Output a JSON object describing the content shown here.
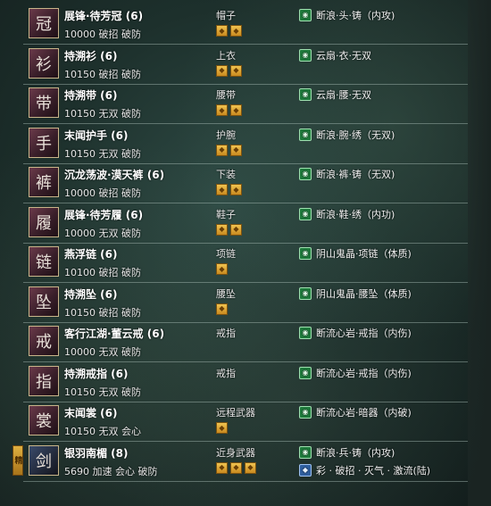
{
  "items": [
    {
      "name": "展锋·待芳冠 (6)",
      "stats": "10000 破招 破防",
      "slot": "帽子",
      "gems": 2,
      "enchant": "断浪·头·铸（内攻)",
      "enchant_icon": "jade-icon"
    },
    {
      "name": "持溯衫 (6)",
      "stats": "10150 破招 破防",
      "slot": "上衣",
      "gems": 2,
      "enchant": "云扇·衣·无双",
      "enchant_icon": "jade-icon"
    },
    {
      "name": "持溯带 (6)",
      "stats": "10150 无双 破防",
      "slot": "腰带",
      "gems": 2,
      "enchant": "云扇·腰·无双",
      "enchant_icon": "jade-icon"
    },
    {
      "name": "末闻护手 (6)",
      "stats": "10150 无双 破防",
      "slot": "护腕",
      "gems": 2,
      "enchant": "断浪·腕·绣（无双)",
      "enchant_icon": "jade-icon"
    },
    {
      "name": "沉龙荡波·漠天裤 (6)",
      "stats": "10000 破招 破防",
      "slot": "下装",
      "gems": 2,
      "enchant": "断浪·裤·铸（无双)",
      "enchant_icon": "jade-icon"
    },
    {
      "name": "展锋·待芳履 (6)",
      "stats": "10000 无双 破防",
      "slot": "鞋子",
      "gems": 2,
      "enchant": "断浪·鞋·绣（内功)",
      "enchant_icon": "jade-icon"
    },
    {
      "name": "燕浮链 (6)",
      "stats": "10100 破招 破防",
      "slot": "项链",
      "gems": 1,
      "enchant": "阴山鬼晶·项链（体质)",
      "enchant_icon": "jade-icon"
    },
    {
      "name": "持溯坠 (6)",
      "stats": "10150 破招 破防",
      "slot": "腰坠",
      "gems": 1,
      "enchant": "阴山鬼晶·腰坠（体质)",
      "enchant_icon": "jade-icon"
    },
    {
      "name": "客行江湖·董云戒 (6)",
      "stats": "10000 无双 破防",
      "slot": "戒指",
      "gems": 0,
      "enchant": "断流心岩·戒指（内伤)",
      "enchant_icon": "jade-icon"
    },
    {
      "name": "持溯戒指 (6)",
      "stats": "10150 无双 破防",
      "slot": "戒指",
      "gems": 0,
      "enchant": "断流心岩·戒指（内伤)",
      "enchant_icon": "jade-icon"
    },
    {
      "name": "末闻裳 (6)",
      "stats": "10150 无双 会心",
      "slot": "远程武器",
      "gems": 1,
      "enchant": "断流心岩·暗器（内破)",
      "enchant_icon": "jade-icon"
    },
    {
      "name": "银羽南楣 (8)",
      "stats": "5690 加速 会心 破防",
      "slot": "近身武器",
      "gems": 3,
      "enchant": "断浪·兵·铸（内攻)",
      "enchant_icon": "jade-icon",
      "enchant2": "彩 · 破招 · 灭气 · 激流(陆)",
      "enchant2_icon": "colored-gem-icon",
      "badge": "精"
    }
  ]
}
